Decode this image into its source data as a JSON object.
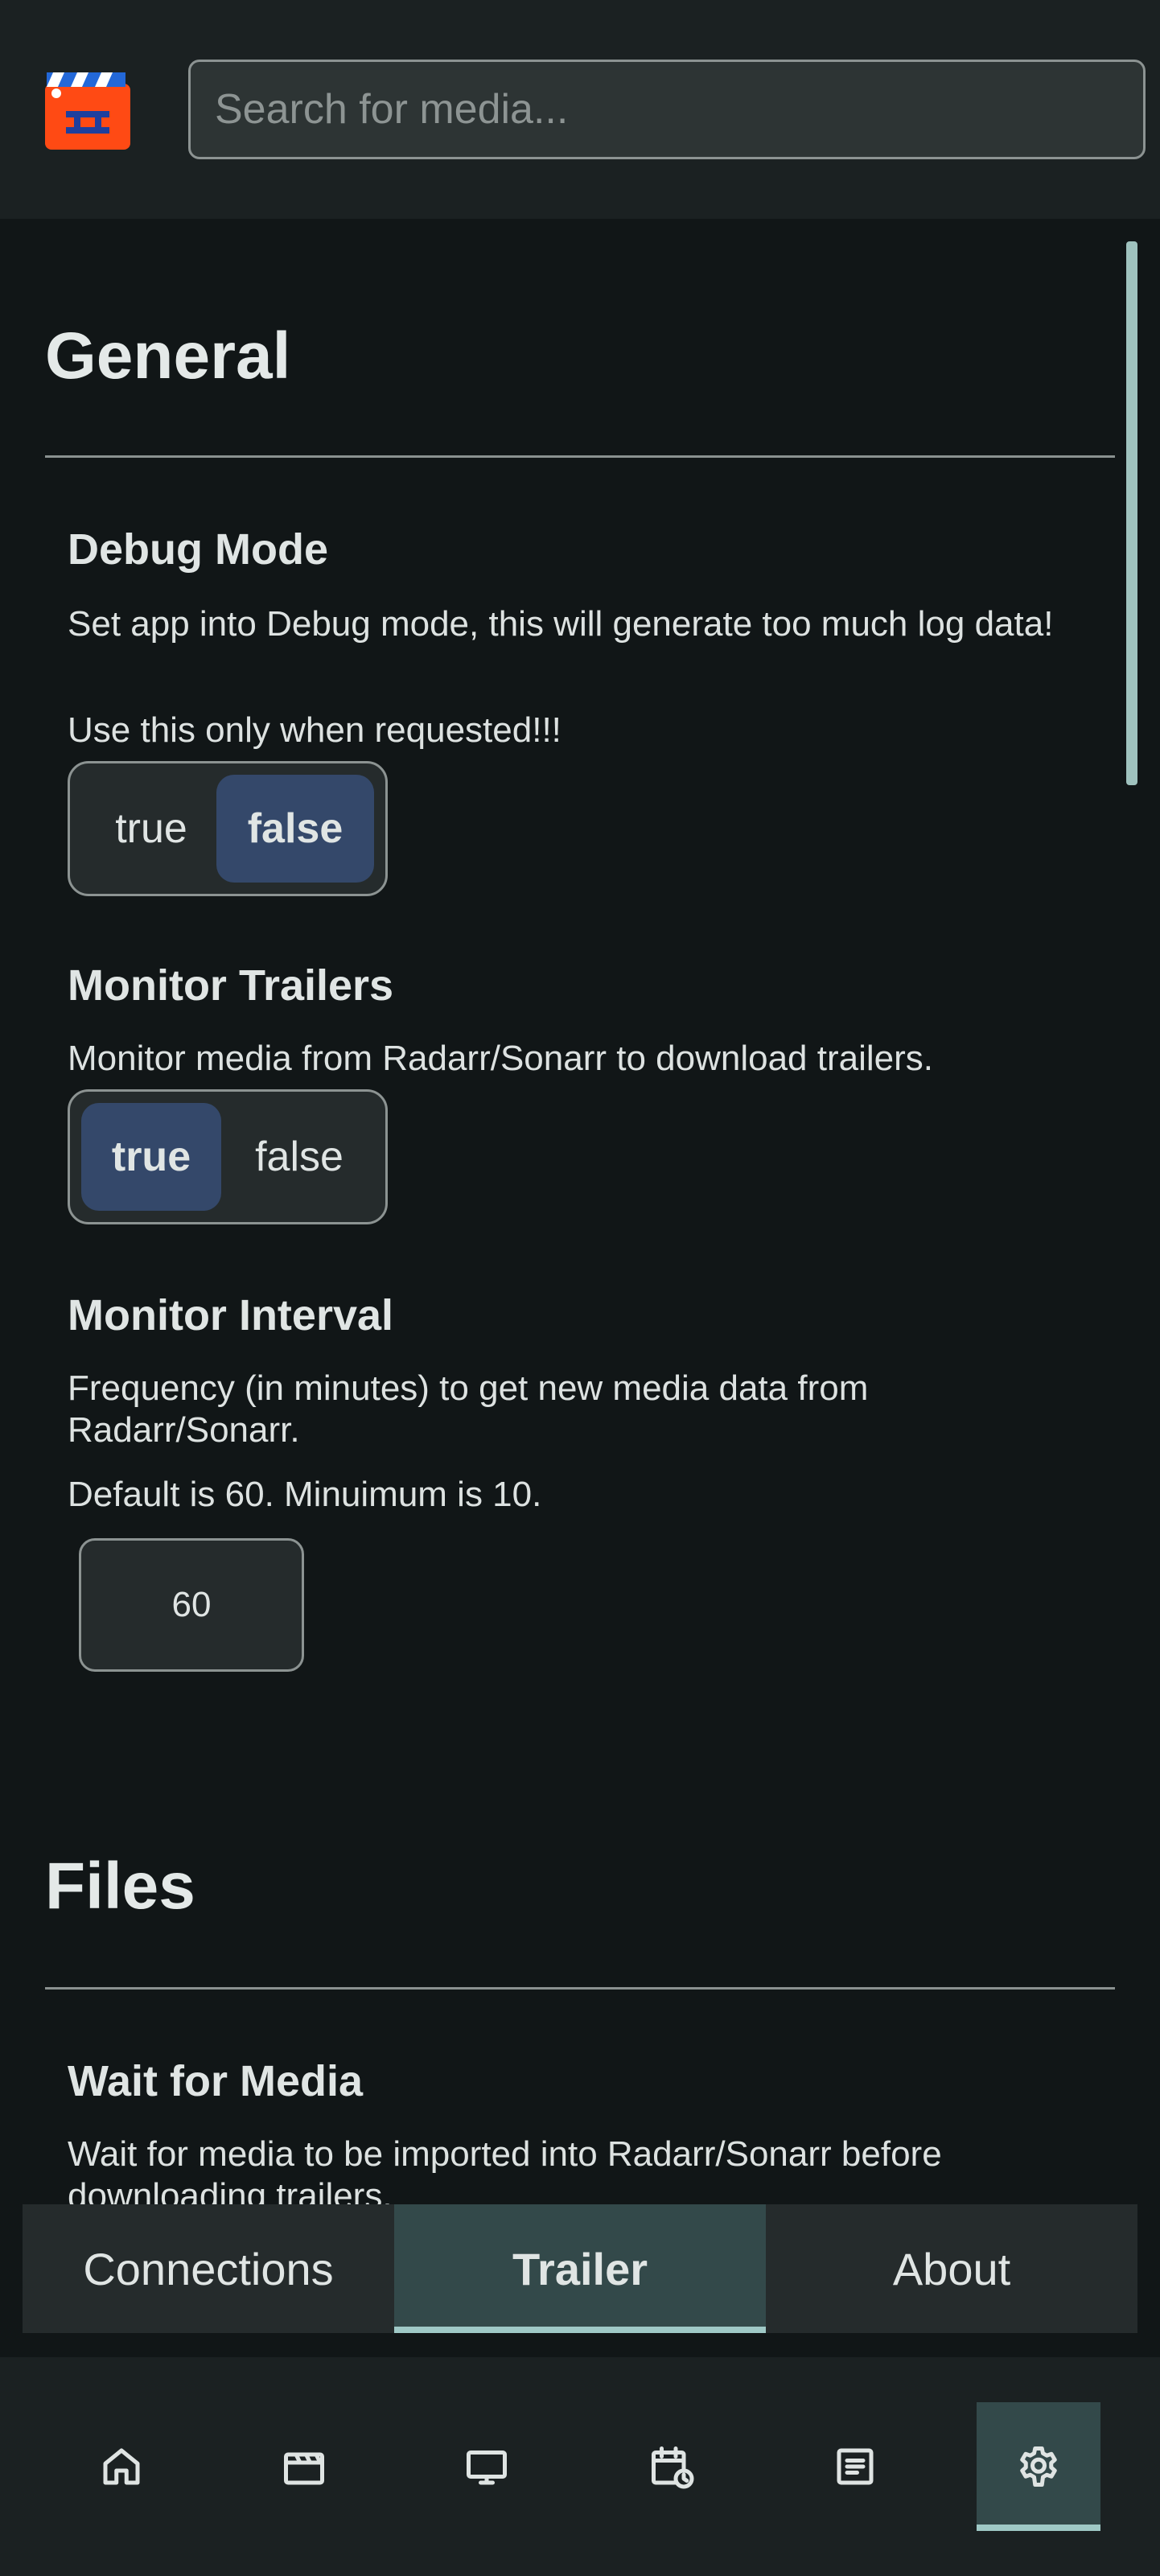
{
  "search": {
    "placeholder": "Search for media..."
  },
  "sections": {
    "general": {
      "title": "General",
      "debug_mode": {
        "title": "Debug Mode",
        "desc": "Set app into Debug mode, this will generate too much log data!",
        "note": "Use this only when requested!!!",
        "options": [
          "true",
          "false"
        ],
        "selected": "false"
      },
      "monitor_trailers": {
        "title": "Monitor Trailers",
        "desc": "Monitor media from Radarr/Sonarr to download trailers.",
        "options": [
          "true",
          "false"
        ],
        "selected": "true"
      },
      "monitor_interval": {
        "title": "Monitor Interval",
        "desc": "Frequency (in minutes) to get new media data from Radarr/Sonarr.",
        "note": "Default is 60. Minuimum is 10.",
        "value": "60"
      }
    },
    "files": {
      "title": "Files",
      "wait_for_media": {
        "title": "Wait for Media",
        "desc": "Wait for media to be imported into Radarr/Sonarr before downloading trailers."
      }
    }
  },
  "tabs": [
    {
      "label": "Connections",
      "active": false
    },
    {
      "label": "Trailer",
      "active": true
    },
    {
      "label": "About",
      "active": false
    }
  ],
  "bottom_nav": [
    {
      "icon": "home-icon",
      "active": false
    },
    {
      "icon": "movie-clapper-icon",
      "active": false
    },
    {
      "icon": "tv-icon",
      "active": false
    },
    {
      "icon": "calendar-clock-icon",
      "active": false
    },
    {
      "icon": "logs-icon",
      "active": false
    },
    {
      "icon": "gear-icon",
      "active": true
    }
  ],
  "colors": {
    "background": "#111617",
    "bar": "#1b2122",
    "selected_option": "#34486a",
    "active_tab": "#33494a",
    "accent": "#9fc9c6",
    "logo": "#ff4a14"
  }
}
